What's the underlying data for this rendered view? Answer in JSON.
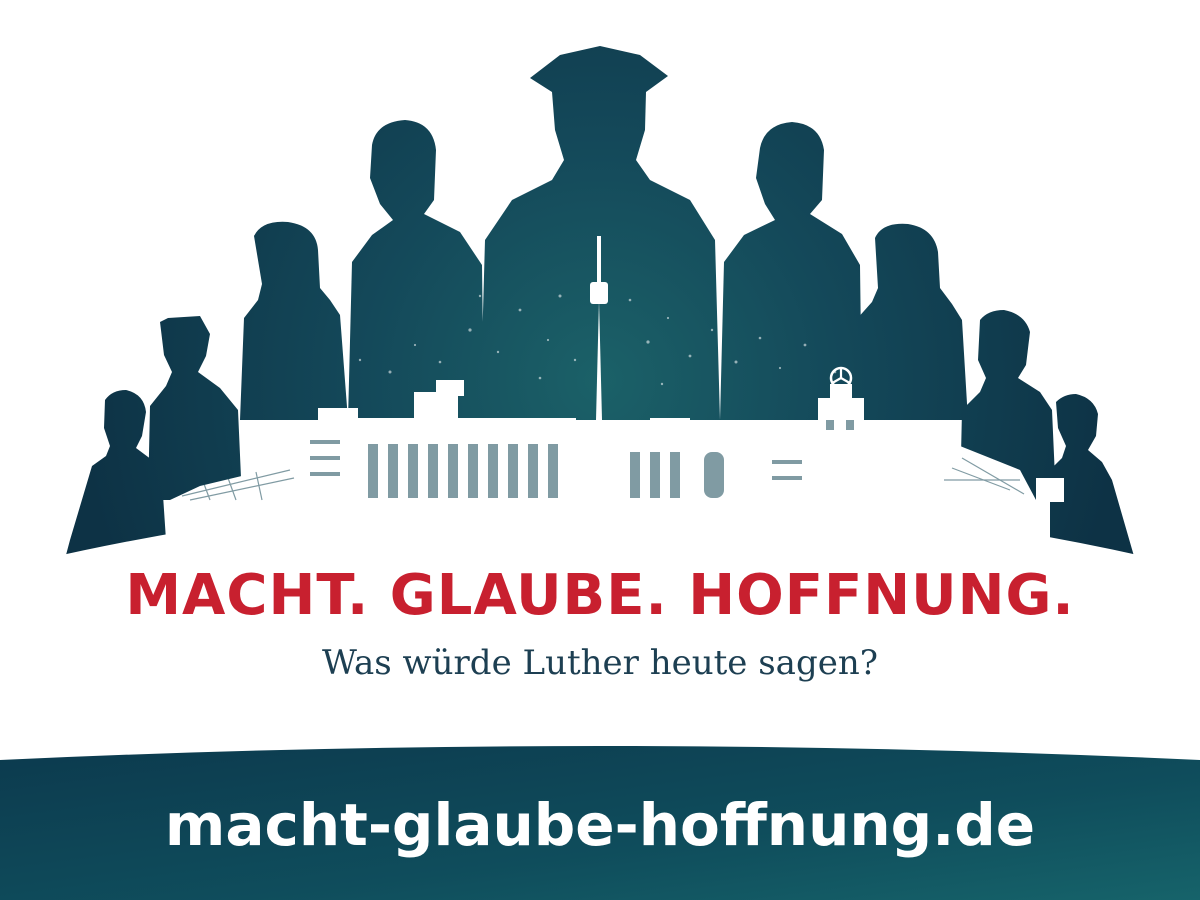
{
  "poster": {
    "headline": "MACHT. GLAUBE. HOFFNUNG.",
    "tagline": "Was würde Luther heute sagen?",
    "website": "macht-glaube-hoffnung.de"
  },
  "colors": {
    "silhouette_dark": "#0e3548",
    "silhouette_light": "#1a5a62",
    "headline_red": "#c8202f",
    "tagline_navy": "#1d3f52",
    "band_dark": "#0c3a4e",
    "band_light": "#16636a",
    "background": "#ffffff"
  },
  "icons": {
    "tower": "tv-tower-icon",
    "star": "mercedes-star-icon"
  }
}
